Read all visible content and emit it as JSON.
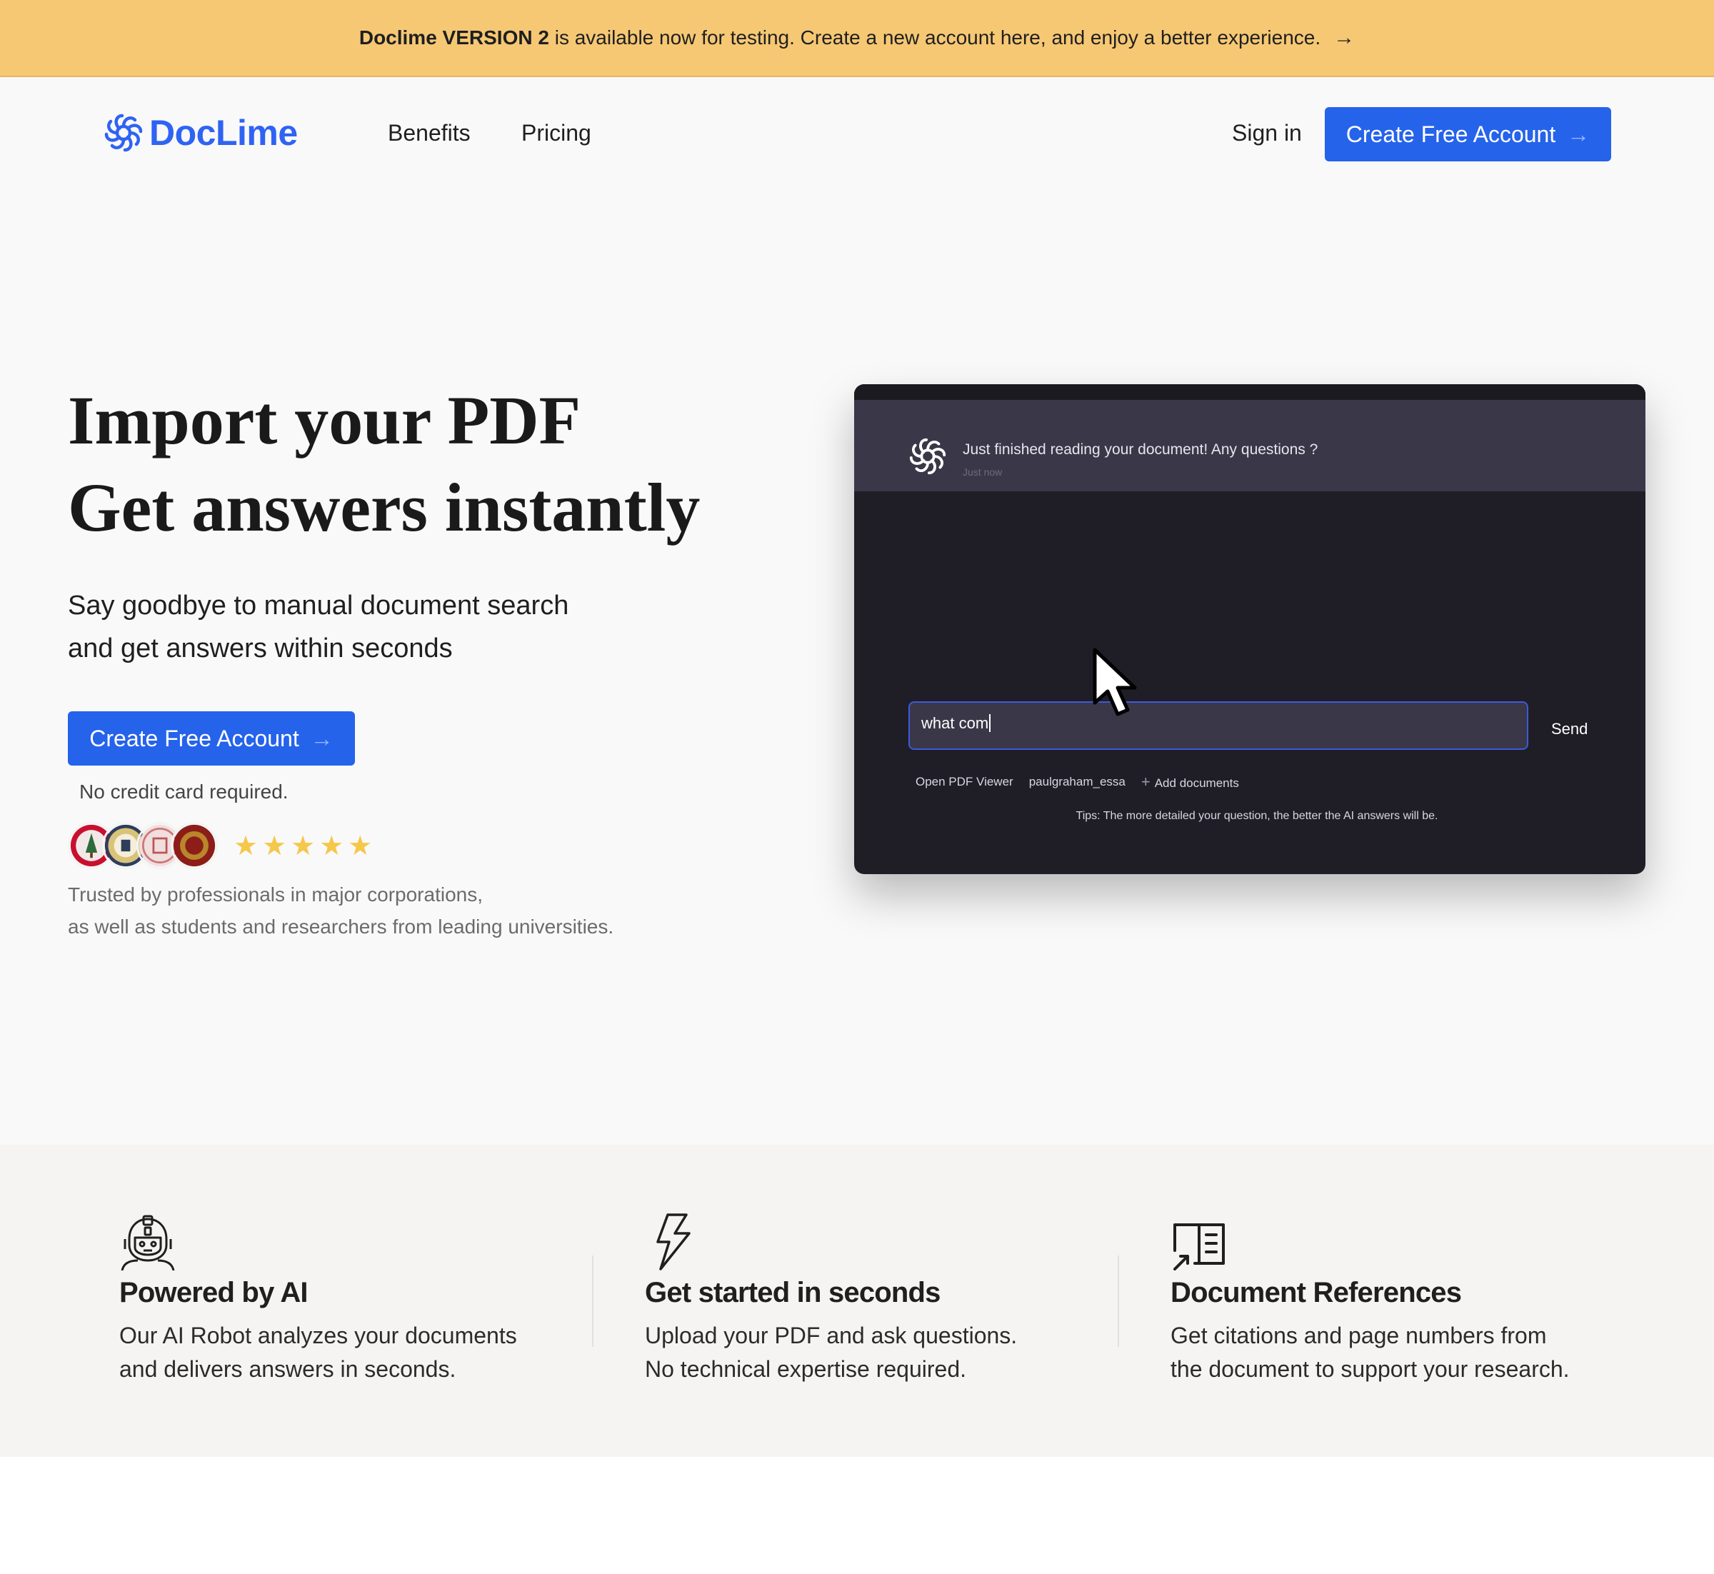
{
  "banner": {
    "bold_text": "Doclime VERSION 2",
    "text": " is available now for testing. Create a new account here, and enjoy a better experience.",
    "arrow": "→"
  },
  "nav": {
    "logo_text": "DocLime",
    "links": [
      "Benefits",
      "Pricing"
    ],
    "signin": "Sign in",
    "cta": "Create Free Account",
    "cta_arrow": "→"
  },
  "hero": {
    "title_line1": "Import your PDF",
    "title_line2": "Get answers instantly",
    "subtitle_line1": "Say goodbye to manual document search",
    "subtitle_line2": "and get answers within seconds",
    "cta": "Create Free Account",
    "cta_arrow": "→",
    "no_credit_card": "No credit card required.",
    "rating_stars": "★★★★★",
    "rating_value": 5,
    "trusted_line1": "Trusted by professionals in major corporations,",
    "trusted_line2": "as well as students and researchers from leading universities."
  },
  "preview": {
    "assistant_message": "Just finished reading your document! Any questions ?",
    "message_time": "Just now",
    "input_value": "what com",
    "send_label": "Send",
    "chips": [
      "Open PDF Viewer",
      "paulgraham_essa",
      "Add documents"
    ],
    "tips": "Tips: The more detailed your question, the better the AI answers will be."
  },
  "features": [
    {
      "icon": "robot-icon",
      "title": "Powered by AI",
      "line1": "Our AI Robot analyzes your documents",
      "line2": "and delivers answers in seconds."
    },
    {
      "icon": "lightning-icon",
      "title": "Get started in seconds",
      "line1": "Upload your PDF and ask questions.",
      "line2": "No technical expertise required."
    },
    {
      "icon": "document-reference-icon",
      "title": "Document References",
      "line1": "Get citations and page numbers from",
      "line2": "the document to support your research."
    }
  ],
  "colors": {
    "banner_bg": "#f6c874",
    "brand_blue": "#2563eb",
    "logo_blue": "#2f63f3",
    "star_yellow": "#f5c84a",
    "preview_bg": "#1f1e27"
  }
}
